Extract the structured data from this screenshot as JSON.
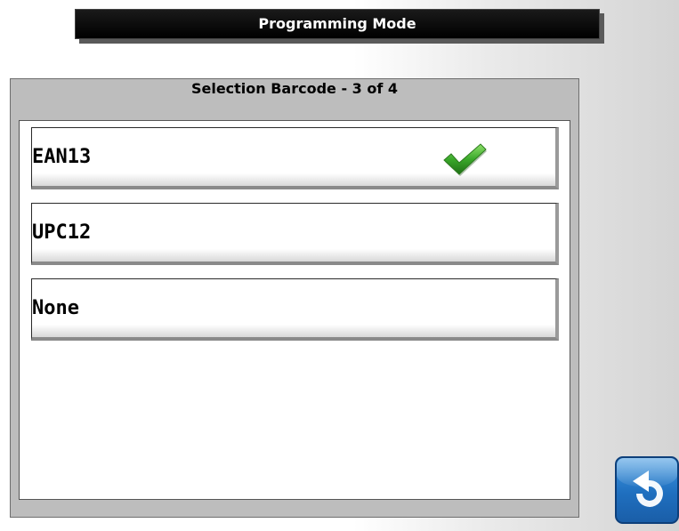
{
  "header": {
    "title": "Programming Mode"
  },
  "panel": {
    "title": "Selection Barcode - 3 of 4"
  },
  "options": [
    {
      "label": "EAN13",
      "selected": true
    },
    {
      "label": "UPC12",
      "selected": false
    },
    {
      "label": "None",
      "selected": false
    }
  ],
  "icons": {
    "selected_marker": "checkmark-icon",
    "back": "back-arrow-icon"
  },
  "colors": {
    "check": "#3aa82a",
    "back_button": "#2a7fd0"
  }
}
